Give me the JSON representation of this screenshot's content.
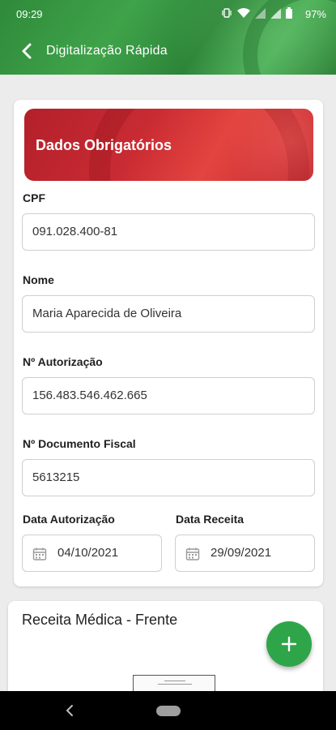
{
  "status_bar": {
    "time": "09:29",
    "battery": "97%",
    "icons": [
      "vibrate-icon",
      "wifi-icon",
      "signal-icon",
      "signal-icon",
      "battery-icon"
    ]
  },
  "header": {
    "title": "Digitalização Rápida",
    "back_icon": "chevron-left-icon"
  },
  "form": {
    "banner_title": "Dados Obrigatórios",
    "cpf": {
      "label": "CPF",
      "value": "091.028.400-81"
    },
    "nome": {
      "label": "Nome",
      "value": "Maria Aparecida de Oliveira"
    },
    "autorizacao": {
      "label": "Nº Autorização",
      "value": "156.483.546.462.665"
    },
    "documento_fiscal": {
      "label": "Nº Documento Fiscal",
      "value": "5613215"
    },
    "data_autorizacao": {
      "label": "Data Autorização",
      "value": "04/10/2021",
      "icon": "calendar-icon"
    },
    "data_receita": {
      "label": "Data Receita",
      "value": "29/09/2021",
      "icon": "calendar-icon"
    }
  },
  "receita": {
    "title": "Receita Médica - Frente"
  },
  "fab": {
    "icon": "plus-icon"
  },
  "colors": {
    "header_green": "#3fa34a",
    "banner_red": "#c92b33",
    "fab_green": "#2fa54a"
  }
}
